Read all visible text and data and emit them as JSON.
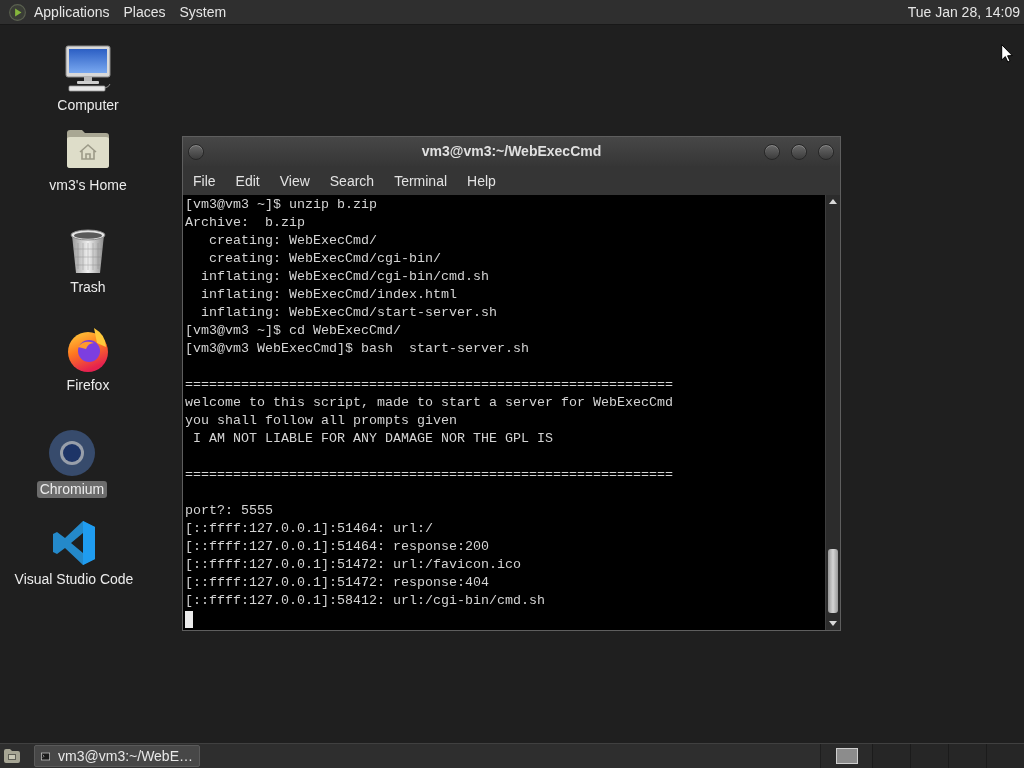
{
  "top_panel": {
    "menus": [
      "Applications",
      "Places",
      "System"
    ],
    "clock": "Tue Jan 28, 14:09"
  },
  "desktop_icons": [
    {
      "label": "Computer",
      "kind": "computer",
      "selected": false
    },
    {
      "label": "vm3's Home",
      "kind": "home",
      "selected": false
    },
    {
      "label": "Trash",
      "kind": "trash",
      "selected": false
    },
    {
      "label": "Firefox",
      "kind": "firefox",
      "selected": false
    },
    {
      "label": "Chromium",
      "kind": "chromium",
      "selected": true
    },
    {
      "label": "Visual Studio Code",
      "kind": "vscode",
      "selected": false
    }
  ],
  "terminal_window": {
    "title": "vm3@vm3:~/WebExecCmd",
    "menu": [
      "File",
      "Edit",
      "View",
      "Search",
      "Terminal",
      "Help"
    ],
    "lines": [
      {
        "kind": "text",
        "text": "[vm3@vm3 ~]$ unzip b.zip"
      },
      {
        "kind": "text",
        "text": "Archive:  b.zip"
      },
      {
        "kind": "text",
        "text": "   creating: WebExecCmd/"
      },
      {
        "kind": "text",
        "text": "   creating: WebExecCmd/cgi-bin/"
      },
      {
        "kind": "text",
        "text": "  inflating: WebExecCmd/cgi-bin/cmd.sh"
      },
      {
        "kind": "text",
        "text": "  inflating: WebExecCmd/index.html"
      },
      {
        "kind": "text",
        "text": "  inflating: WebExecCmd/start-server.sh"
      },
      {
        "kind": "text",
        "text": "[vm3@vm3 ~]$ cd WebExecCmd/"
      },
      {
        "kind": "text",
        "text": "[vm3@vm3 WebExecCmd]$ bash  start-server.sh"
      },
      {
        "kind": "blank"
      },
      {
        "kind": "text",
        "text": "============================================================="
      },
      {
        "kind": "text",
        "text": "welcome to this script, made to start a server for WebExecCmd"
      },
      {
        "kind": "text",
        "text": "you shall follow all prompts given"
      },
      {
        "kind": "text",
        "text": " I AM NOT LIABLE FOR ANY DAMAGE NOR THE GPL IS"
      },
      {
        "kind": "blank"
      },
      {
        "kind": "text",
        "text": "============================================================="
      },
      {
        "kind": "blank"
      },
      {
        "kind": "text",
        "text": "port?: 5555"
      },
      {
        "kind": "text",
        "text": "[::ffff:127.0.0.1]:51464: url:/"
      },
      {
        "kind": "text",
        "text": "[::ffff:127.0.0.1]:51464: response:200"
      },
      {
        "kind": "text",
        "text": "[::ffff:127.0.0.1]:51472: url:/favicon.ico"
      },
      {
        "kind": "text",
        "text": "[::ffff:127.0.0.1]:51472: response:404"
      },
      {
        "kind": "text",
        "text": "[::ffff:127.0.0.1]:58412: url:/cgi-bin/cmd.sh"
      }
    ],
    "cursor": true
  },
  "taskbar": {
    "tasks": [
      {
        "label": "vm3@vm3:~/WebE…"
      }
    ]
  }
}
